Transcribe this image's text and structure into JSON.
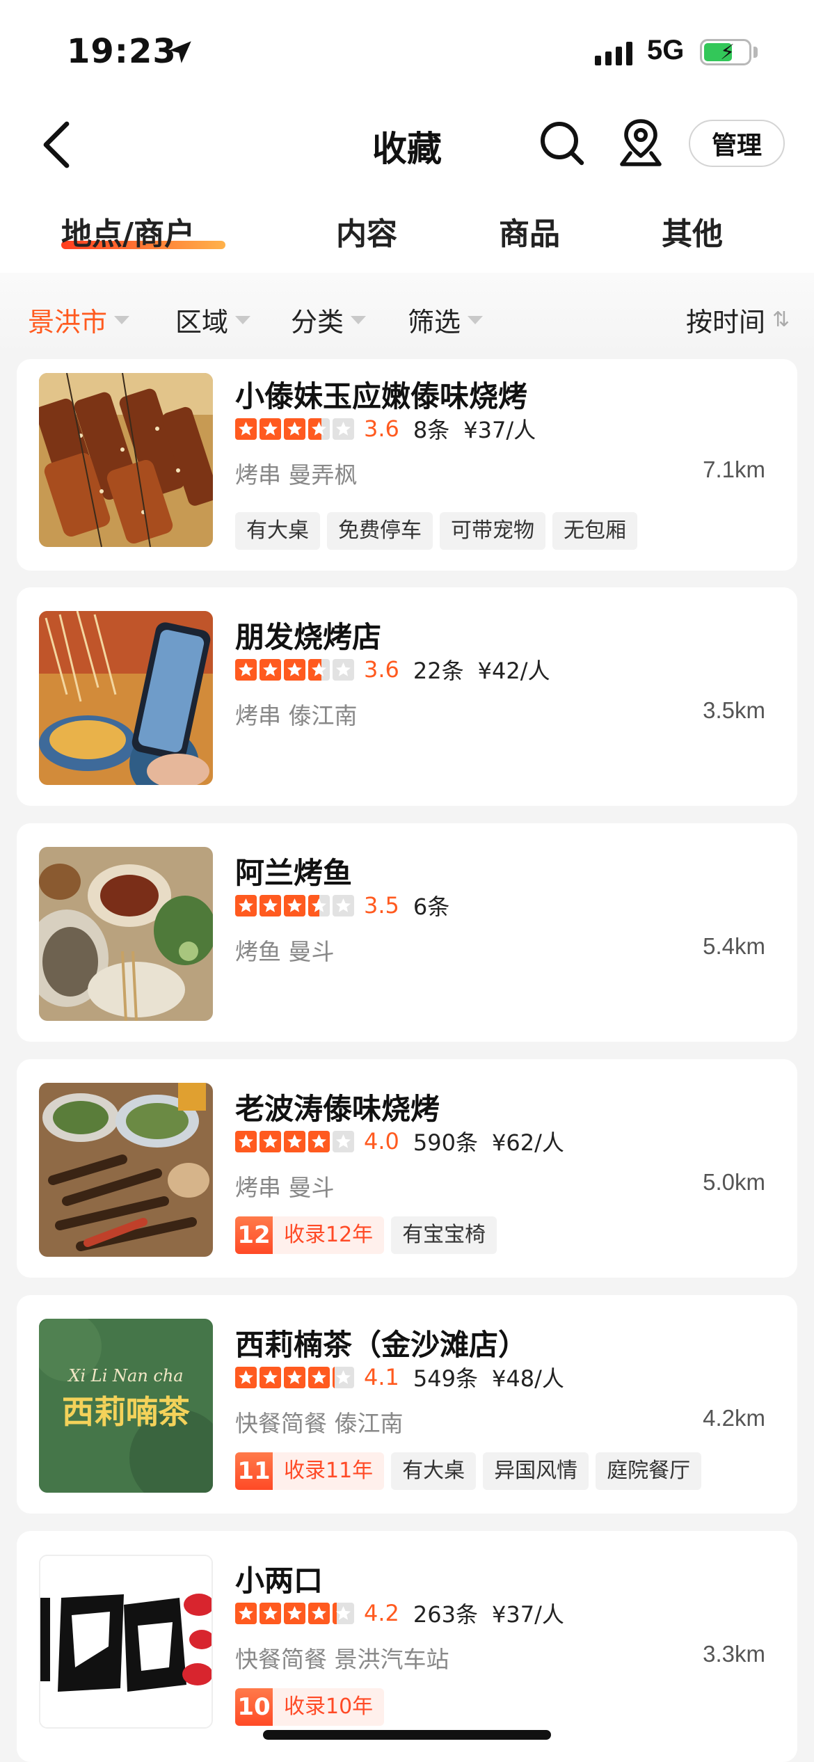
{
  "status_bar": {
    "time": "19:23",
    "network": "5G"
  },
  "nav": {
    "title": "收藏",
    "manage_label": "管理"
  },
  "tabs": [
    {
      "label": "地点/商户",
      "active": true
    },
    {
      "label": "内容",
      "active": false
    },
    {
      "label": "商品",
      "active": false
    },
    {
      "label": "其他",
      "active": false
    }
  ],
  "filters": {
    "city": "景洪市",
    "area": "区域",
    "category": "分类",
    "filter": "筛选",
    "sort": "按时间"
  },
  "colors": {
    "accent": "#ff5a1f",
    "star_empty": "#e2e2e2",
    "battery": "#33c759"
  },
  "places": [
    {
      "name": "小傣妹玉应嫩傣味烧烤",
      "rating": "3.6",
      "rating_value": 3.6,
      "reviews": "8条",
      "price": "¥37/人",
      "category": "烤串",
      "area": "曼弄枫",
      "distance": "7.1km",
      "tags": [
        "有大桌",
        "免费停车",
        "可带宠物",
        "无包厢"
      ]
    },
    {
      "name": "朋发烧烤店",
      "rating": "3.6",
      "rating_value": 3.6,
      "reviews": "22条",
      "price": "¥42/人",
      "category": "烤串",
      "area": "傣江南",
      "distance": "3.5km"
    },
    {
      "name": "阿兰烤鱼",
      "rating": "3.5",
      "rating_value": 3.5,
      "reviews": "6条",
      "category": "烤鱼",
      "area": "曼斗",
      "distance": "5.4km"
    },
    {
      "name": "老波涛傣味烧烤",
      "rating": "4.0",
      "rating_value": 4.0,
      "reviews": "590条",
      "price": "¥62/人",
      "category": "烤串",
      "area": "曼斗",
      "distance": "5.0km",
      "badge_num": "12",
      "badge_text": "收录12年",
      "tags": [
        "有宝宝椅"
      ]
    },
    {
      "name": "西莉楠茶（金沙滩店）",
      "rating": "4.1",
      "rating_value": 4.1,
      "reviews": "549条",
      "price": "¥48/人",
      "category": "快餐简餐",
      "area": "傣江南",
      "distance": "4.2km",
      "badge_num": "11",
      "badge_text": "收录11年",
      "tags": [
        "有大桌",
        "异国风情",
        "庭院餐厅"
      ],
      "logo_latin": "Xi Li Nan cha",
      "logo_cn": "西莉喃茶"
    },
    {
      "name": "小两口",
      "rating": "4.2",
      "rating_value": 4.2,
      "reviews": "263条",
      "price": "¥37/人",
      "category": "快餐简餐",
      "area": "景洪汽车站",
      "distance": "3.3km",
      "badge_num": "10",
      "badge_text": "收录10年"
    }
  ]
}
